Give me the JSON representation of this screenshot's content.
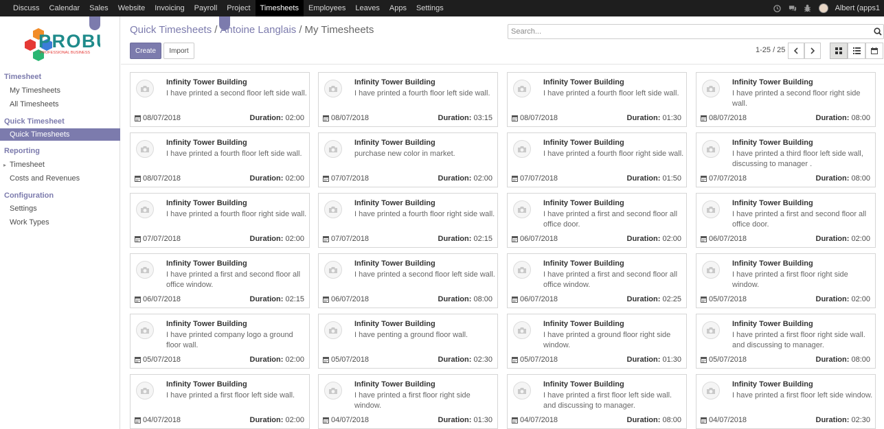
{
  "topbar": {
    "menu": [
      "Discuss",
      "Calendar",
      "Sales",
      "Website",
      "Invoicing",
      "Payroll",
      "Project",
      "Timesheets",
      "Employees",
      "Leaves",
      "Apps",
      "Settings"
    ],
    "active": "Timesheets",
    "user": "Albert (apps1"
  },
  "logo": {
    "text": "PROBUSE",
    "tagline": "PROFESSIONAL BUSINESS"
  },
  "sidebar": {
    "sections": [
      {
        "header": "Timesheet",
        "items": [
          "My Timesheets",
          "All Timesheets"
        ]
      },
      {
        "header": "Quick Timesheet",
        "items": [
          "Quick Timesheets"
        ]
      },
      {
        "header": "Reporting",
        "items": [
          "Timesheet",
          "Costs and Revenues"
        ]
      },
      {
        "header": "Configuration",
        "items": [
          "Settings",
          "Work Types"
        ]
      }
    ],
    "active_item": "Quick Timesheets"
  },
  "breadcrumb": {
    "b1": "Quick Timesheets",
    "b2": "Antoine Langlais",
    "b3": "My Timesheets",
    "sep": "/"
  },
  "buttons": {
    "create": "Create",
    "import": "Import"
  },
  "search": {
    "placeholder": "Search..."
  },
  "pager": {
    "text": "1-25 / 25"
  },
  "labels": {
    "duration": "Duration:"
  },
  "cards": [
    {
      "title": "Infinity Tower Building",
      "desc": "I have printed a second floor left side wall.",
      "date": "08/07/2018",
      "duration": "02:00"
    },
    {
      "title": "Infinity Tower Building",
      "desc": "I have printed a fourth floor left side wall.",
      "date": "08/07/2018",
      "duration": "03:15"
    },
    {
      "title": "Infinity Tower Building",
      "desc": "I have printed a fourth floor left side wall.",
      "date": "08/07/2018",
      "duration": "01:30"
    },
    {
      "title": "Infinity Tower Building",
      "desc": "I have printed a second floor right side wall.",
      "date": "08/07/2018",
      "duration": "08:00"
    },
    {
      "title": "Infinity Tower Building",
      "desc": "I have printed a fourth floor left side wall.",
      "date": "08/07/2018",
      "duration": "02:00"
    },
    {
      "title": "Infinity Tower Building",
      "desc": "purchase new color in market.",
      "date": "07/07/2018",
      "duration": "02:00"
    },
    {
      "title": "Infinity Tower Building",
      "desc": "I have printed a fourth floor right side wall.",
      "date": "07/07/2018",
      "duration": "01:50"
    },
    {
      "title": "Infinity Tower Building",
      "desc": "I have printed a third floor left side wall, discussing to manager .",
      "date": "07/07/2018",
      "duration": "08:00"
    },
    {
      "title": "Infinity Tower Building",
      "desc": "I have printed a fourth floor right side wall.",
      "date": "07/07/2018",
      "duration": "02:00"
    },
    {
      "title": "Infinity Tower Building",
      "desc": "I have printed a fourth floor right side wall.",
      "date": "07/07/2018",
      "duration": "02:15"
    },
    {
      "title": "Infinity Tower Building",
      "desc": "I have printed a first and second floor all office door.",
      "date": "06/07/2018",
      "duration": "02:00"
    },
    {
      "title": "Infinity Tower Building",
      "desc": "I have printed a first and second floor all office door.",
      "date": "06/07/2018",
      "duration": "02:00"
    },
    {
      "title": "Infinity Tower Building",
      "desc": "I have printed a first and second floor all office window.",
      "date": "06/07/2018",
      "duration": "02:15"
    },
    {
      "title": "Infinity Tower Building",
      "desc": "I have printed a second floor left side wall.",
      "date": "06/07/2018",
      "duration": "08:00"
    },
    {
      "title": "Infinity Tower Building",
      "desc": "I have printed a first and second floor all office window.",
      "date": "06/07/2018",
      "duration": "02:25"
    },
    {
      "title": "Infinity Tower Building",
      "desc": "I have printed a first floor right side window.",
      "date": "05/07/2018",
      "duration": "02:00"
    },
    {
      "title": "Infinity Tower Building",
      "desc": "I have printed company logo a ground floor wall.",
      "date": "05/07/2018",
      "duration": "02:00"
    },
    {
      "title": "Infinity Tower Building",
      "desc": "I have penting a ground floor wall.",
      "date": "05/07/2018",
      "duration": "02:30"
    },
    {
      "title": "Infinity Tower Building",
      "desc": "I have printed a ground floor right side window.",
      "date": "05/07/2018",
      "duration": "01:30"
    },
    {
      "title": "Infinity Tower Building",
      "desc": "I have printed a first floor right side wall. and discussing to manager.",
      "date": "05/07/2018",
      "duration": "08:00"
    },
    {
      "title": "Infinity Tower Building",
      "desc": "I have printed a first floor left side wall.",
      "date": "04/07/2018",
      "duration": "02:00"
    },
    {
      "title": "Infinity Tower Building",
      "desc": "I have printed a first floor right side window.",
      "date": "04/07/2018",
      "duration": "01:30"
    },
    {
      "title": "Infinity Tower Building",
      "desc": "I have printed a first floor left side wall. and discussing to manager.",
      "date": "04/07/2018",
      "duration": "08:00"
    },
    {
      "title": "Infinity Tower Building",
      "desc": "I have printed a first floor left side window.",
      "date": "04/07/2018",
      "duration": "02:30"
    }
  ],
  "colors": {
    "accent": "#7c7bad",
    "topbar": "#1e1e1e"
  },
  "icons": [
    "clock-icon",
    "chat-icon",
    "bug-icon",
    "camera-icon",
    "calendar-icon",
    "search-icon",
    "kanban-view-icon",
    "list-view-icon",
    "calendar-view-icon",
    "chevron-left-icon",
    "chevron-right-icon"
  ]
}
